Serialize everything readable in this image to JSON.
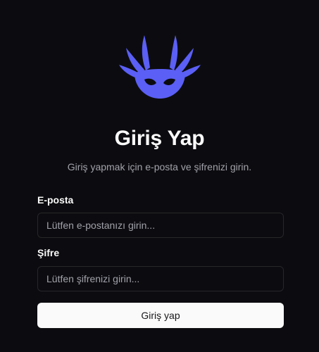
{
  "brand": {
    "logo_icon": "axolotl-mask-icon",
    "accent_color": "#5b5ff5"
  },
  "header": {
    "title": "Giriş Yap",
    "subtitle": "Giriş yapmak için e-posta ve şifrenizi girin."
  },
  "form": {
    "email_label": "E-posta",
    "email_placeholder": "Lütfen e-postanızı girin...",
    "email_value": "",
    "password_label": "Şifre",
    "password_placeholder": "Lütfen şifrenizi girin...",
    "password_value": "",
    "submit_label": "Giriş yap"
  }
}
